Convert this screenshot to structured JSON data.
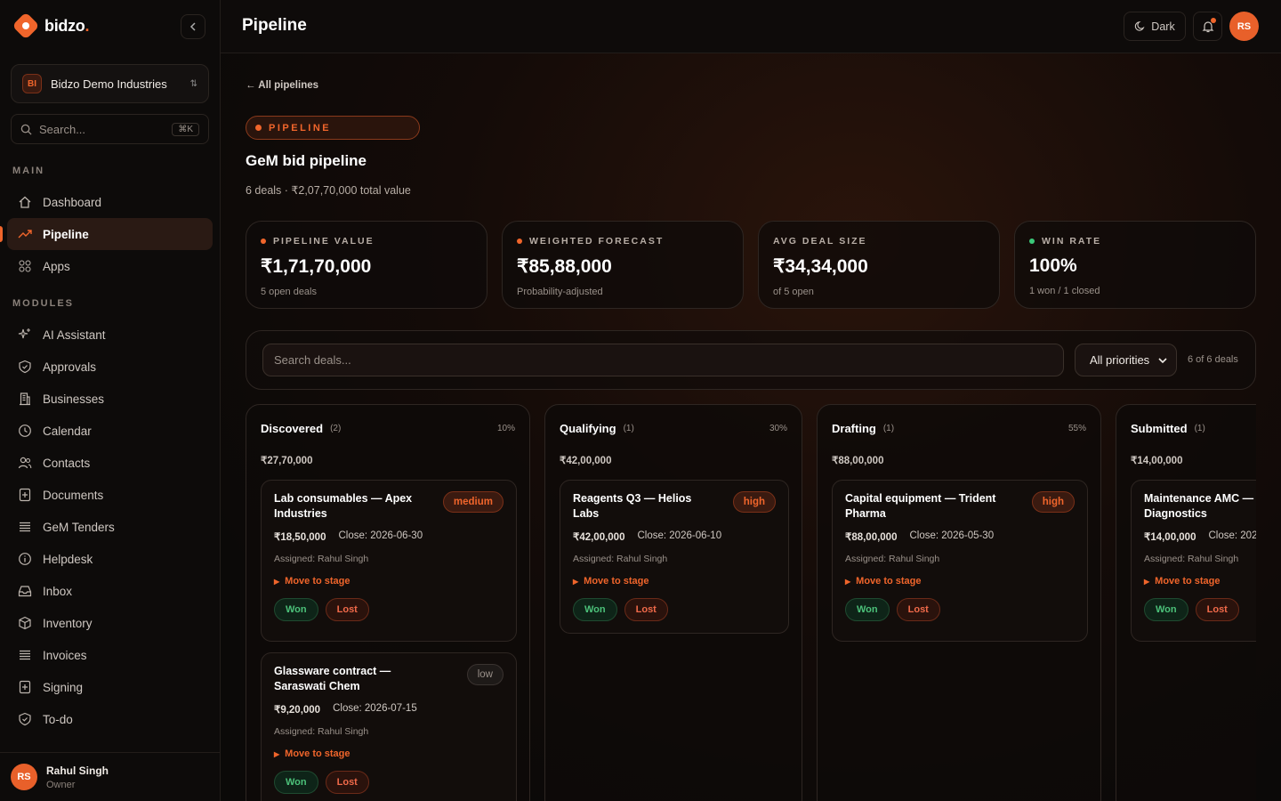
{
  "brand": {
    "name": "bidzo",
    "dot": "."
  },
  "org": {
    "initials": "BI",
    "name": "Bidzo Demo Industries"
  },
  "sidebar_search": {
    "placeholder": "Search...",
    "shortcut": "⌘K"
  },
  "sections": {
    "main": "MAIN",
    "modules": "MODULES"
  },
  "main_nav": [
    {
      "label": "Dashboard",
      "icon": "home-icon"
    },
    {
      "label": "Pipeline",
      "icon": "trending-icon",
      "active": true
    },
    {
      "label": "Apps",
      "icon": "grid-icon"
    }
  ],
  "module_nav": [
    {
      "label": "AI Assistant",
      "icon": "sparkle-icon"
    },
    {
      "label": "Approvals",
      "icon": "shield-icon"
    },
    {
      "label": "Businesses",
      "icon": "building-icon"
    },
    {
      "label": "Calendar",
      "icon": "clock-icon"
    },
    {
      "label": "Contacts",
      "icon": "users-icon"
    },
    {
      "label": "Documents",
      "icon": "document-icon"
    },
    {
      "label": "GeM Tenders",
      "icon": "list-icon"
    },
    {
      "label": "Helpdesk",
      "icon": "info-icon"
    },
    {
      "label": "Inbox",
      "icon": "inbox-icon"
    },
    {
      "label": "Inventory",
      "icon": "box-icon"
    },
    {
      "label": "Invoices",
      "icon": "list-icon"
    },
    {
      "label": "Signing",
      "icon": "document-icon"
    },
    {
      "label": "To-do",
      "icon": "shield-icon"
    }
  ],
  "user": {
    "initials": "RS",
    "name": "Rahul Singh",
    "role": "Owner"
  },
  "topbar": {
    "title": "Pipeline",
    "theme_label": "Dark",
    "avatar": "RS"
  },
  "page": {
    "back_label": "← All pipelines",
    "pill": "PIPELINE",
    "title": "GeM bid pipeline",
    "subtitle": "6 deals · ₹2,07,70,000 total value"
  },
  "kpis": [
    {
      "label": "PIPELINE VALUE",
      "value": "₹1,71,70,000",
      "note": "5 open deals",
      "dot": "#f0652b"
    },
    {
      "label": "WEIGHTED FORECAST",
      "value": "₹85,88,000",
      "note": "Probability-adjusted",
      "dot": "#f0652b"
    },
    {
      "label": "AVG DEAL SIZE",
      "value": "₹34,34,000",
      "note": "of 5 open",
      "dot": ""
    },
    {
      "label": "WIN RATE",
      "value": "100%",
      "note": "1 won / 1 closed",
      "dot": "#3cc97a"
    }
  ],
  "filters": {
    "search_placeholder": "Search deals...",
    "priority": "All priorities",
    "count": "6 of 6 deals"
  },
  "columns": [
    {
      "name": "Discovered",
      "count": "(2)",
      "pct": "10%",
      "total": "₹27,70,000",
      "cards": [
        {
          "title": "Lab consumables — Apex Industries",
          "priority": "medium",
          "amount": "₹18,50,000",
          "close": "Close: 2026-06-30",
          "assigned": "Assigned: Rahul Singh"
        },
        {
          "title": "Glassware contract — Saraswati Chem",
          "priority": "low",
          "amount": "₹9,20,000",
          "close": "Close: 2026-07-15",
          "assigned": "Assigned: Rahul Singh"
        }
      ]
    },
    {
      "name": "Qualifying",
      "count": "(1)",
      "pct": "30%",
      "total": "₹42,00,000",
      "cards": [
        {
          "title": "Reagents Q3 — Helios Labs",
          "priority": "high",
          "amount": "₹42,00,000",
          "close": "Close: 2026-06-10",
          "assigned": "Assigned: Rahul Singh"
        }
      ]
    },
    {
      "name": "Drafting",
      "count": "(1)",
      "pct": "55%",
      "total": "₹88,00,000",
      "cards": [
        {
          "title": "Capital equipment — Trident Pharma",
          "priority": "high",
          "amount": "₹88,00,000",
          "close": "Close: 2026-05-30",
          "assigned": "Assigned: Rahul Singh"
        }
      ]
    },
    {
      "name": "Submitted",
      "count": "(1)",
      "pct": "",
      "total": "₹14,00,000",
      "cards": [
        {
          "title": "Maintenance AMC — Diagnostics",
          "priority": "",
          "amount": "₹14,00,000",
          "close": "Close: 202",
          "assigned": "Assigned: Rahul Singh"
        }
      ]
    }
  ],
  "card_actions": {
    "move": "Move to stage",
    "won": "Won",
    "lost": "Lost"
  }
}
